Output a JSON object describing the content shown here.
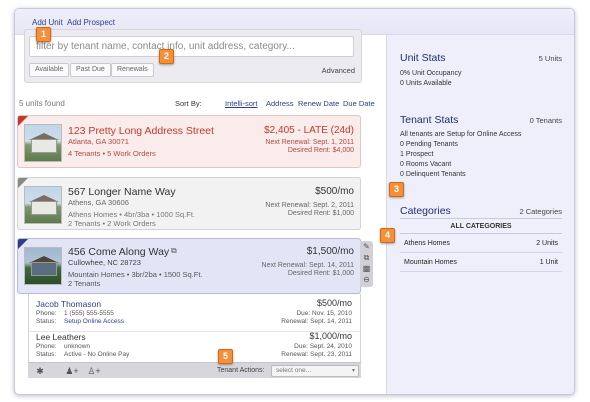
{
  "topbar": {
    "add_unit": "Add Unit",
    "add_prospect": "Add Prospect"
  },
  "search": {
    "placeholder": "filter by tenant name, contact info, unit address, category...",
    "filters": [
      "Available",
      "Past Due",
      "Renewals"
    ],
    "advanced": "Advanced"
  },
  "badges": [
    "1",
    "2",
    "3",
    "4",
    "5"
  ],
  "list": {
    "count_text": "5 units found",
    "sort_by": "Sort By:",
    "sort_options": [
      "Intelli-sort",
      "Address",
      "Renew Date",
      "Due Date"
    ]
  },
  "units": [
    {
      "title": "123 Pretty Long Address Street",
      "city": "Atlanta, GA 30071",
      "meta": "4 Tenants  •  5 Work Orders",
      "price": "$2,405 - LATE (24d)",
      "next_renewal": "Next Renewal:  Sept. 1, 2011",
      "desired_rent": "Desired Rent:  $4,000",
      "accent": "#c0392b"
    },
    {
      "title": "567 Longer Name Way",
      "city": "Athens, GA 30606",
      "meta1": "Athens Homes  •  4br/3ba  •  1000 Sq.Ft.",
      "meta2": "2 Tenants  •  2 Work Orders",
      "price": "$500/mo",
      "next_renewal": "Next Renewal:  Sept. 2, 2011",
      "desired_rent": "Desired Rent:  $1,000"
    },
    {
      "title": "456 Come Along Way",
      "city": "Cullowhee, NC 28723",
      "meta1": "Mountain Homes  •  3br/2ba  •  1500 Sq.Ft.",
      "meta2": "2 Tenants",
      "price": "$1,500/mo",
      "next_renewal": "Next Renewal:  Sept. 14, 2011",
      "desired_rent": "Desired Rent:  $1,000",
      "accent": "#2d3f8a"
    }
  ],
  "tenants": [
    {
      "name": "Jacob Thomason",
      "phone_label": "Phone:",
      "phone": "1 (555) 555-5555",
      "status_label": "Status:",
      "status": "Setup Online Access",
      "price": "$500/mo",
      "due": "Due:   Nov. 15, 2010",
      "renewal": "Renewal:   Sept. 14, 2011"
    },
    {
      "name": "Lee Leathers",
      "phone_label": "Phone:",
      "phone": "unknown",
      "status_label": "Status:",
      "status": "Active - No Online Pay",
      "price": "$1,000/mo",
      "due": "Due:   Sept. 24, 2010",
      "renewal": "Renewal:   Sept. 23, 2011"
    }
  ],
  "tenant_actions": {
    "label": "Tenant Actions:",
    "select_value": "select one..."
  },
  "right_panel": {
    "unit_stats": {
      "title": "Unit Stats",
      "count": "5 Units",
      "lines": [
        "0% Unit Occupancy",
        "0 Units Available"
      ]
    },
    "tenant_stats": {
      "title": "Tenant Stats",
      "count": "0 Tenants",
      "lines": [
        "All tenants are Setup for Online Access",
        "0 Pending Tenants",
        "1 Prospect",
        "0 Rooms Vacant",
        "0 Delinquent Tenants"
      ]
    },
    "categories": {
      "title": "Categories",
      "count": "2 Categories",
      "header": "ALL CATEGORIES",
      "rows": [
        {
          "name": "Athens Homes",
          "value": "2 Units"
        },
        {
          "name": "Mountain Homes",
          "value": "1 Unit"
        }
      ]
    }
  },
  "colors": {
    "link": "#2d3f8a",
    "late": "#c0392b",
    "badge": "#f5903a",
    "panel_bg": "#efeffb"
  }
}
